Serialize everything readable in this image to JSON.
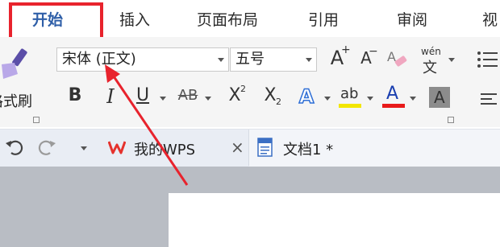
{
  "menu_tabs": [
    "开始",
    "插入",
    "页面布局",
    "引用",
    "审阅",
    "视"
  ],
  "ribbon": {
    "format_painter_label": "格式刷",
    "font_name": "宋体 (正文)",
    "font_size": "五号",
    "grow_font": "A",
    "shrink_font": "A",
    "pinyin_top": "wén",
    "pinyin_bottom": "文",
    "bold": "B",
    "italic": "I",
    "underline": "U",
    "strikethrough": "AB",
    "superscript_base": "X",
    "superscript_exp": "2",
    "subscript_base": "X",
    "subscript_exp": "2",
    "text_effect": "A",
    "highlight": "ab",
    "font_color": "A",
    "char_shading": "A"
  },
  "doc_tabs": [
    {
      "label": "我的WPS",
      "close": "×"
    },
    {
      "label": "文档1 *"
    }
  ],
  "colors": {
    "highlight_box": "#e8232d",
    "annotation_arrow": "#e8232d",
    "highlight_bar": "#f2e600",
    "font_color_bar": "#e81a1a",
    "wps_logo": "#e5322d",
    "text_effect_blue": "#2f6fd6"
  }
}
